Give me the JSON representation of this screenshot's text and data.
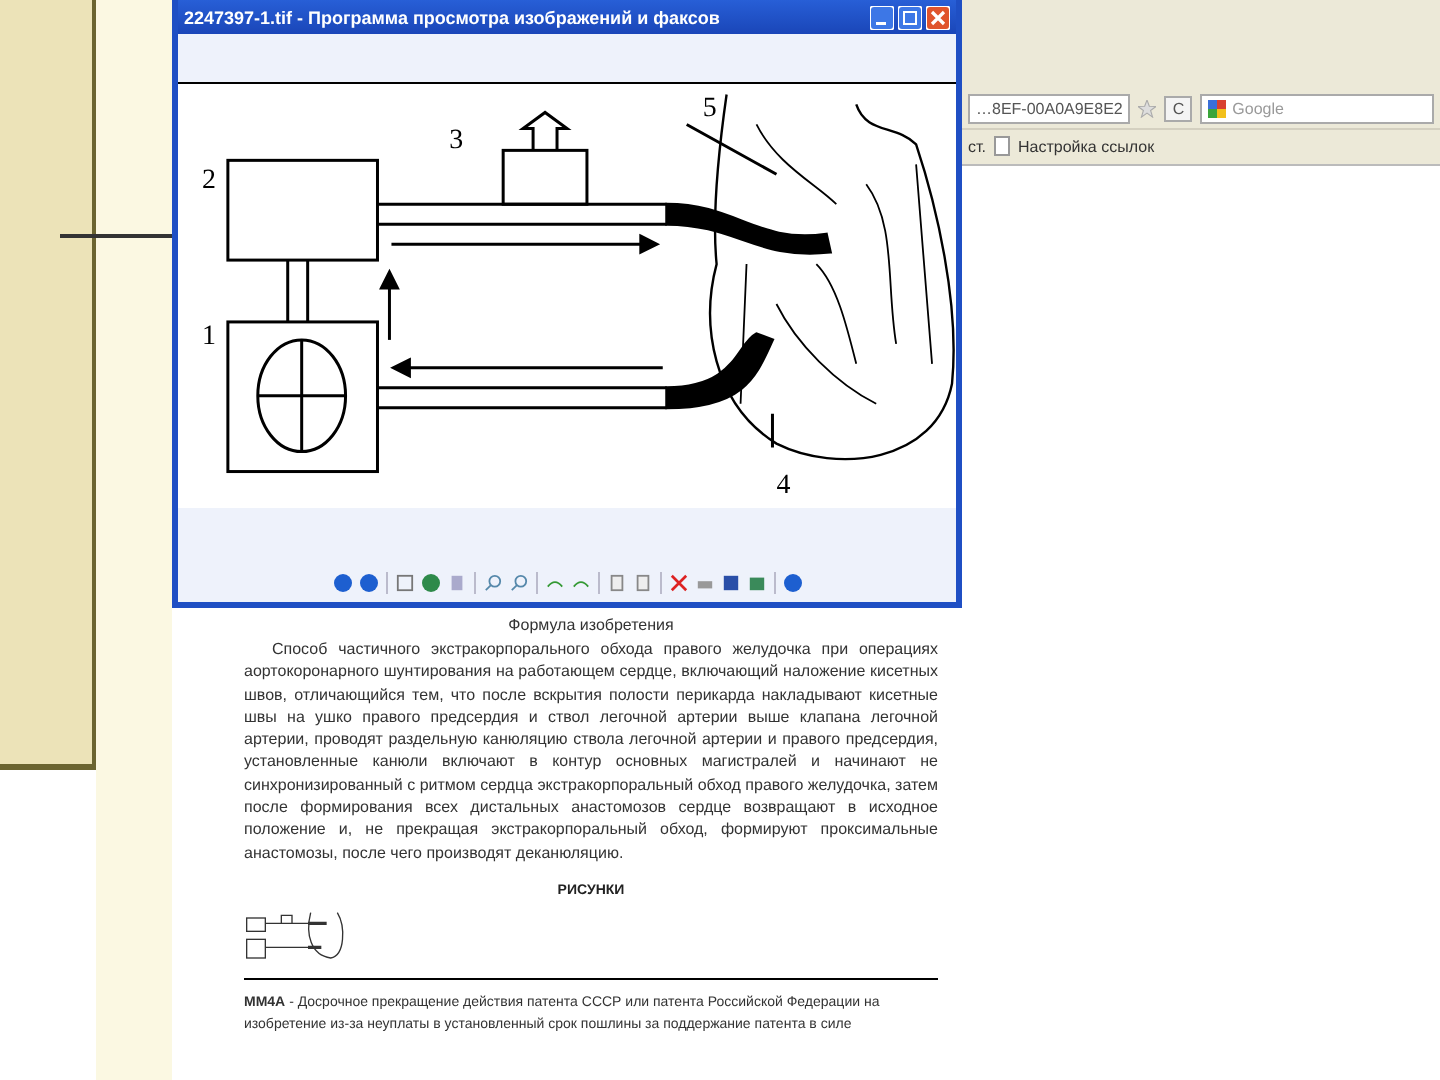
{
  "viewer": {
    "title": "2247397-1.tif - Программа просмотра изображений и факсов",
    "figure_labels": [
      "1",
      "2",
      "3",
      "4",
      "5"
    ]
  },
  "browser": {
    "address": "…8EF-00A0A9E8E2",
    "reload": "C",
    "search_placeholder": "Google",
    "bookmark_prefix": "ст.",
    "bookmark": "Настройка ссылок"
  },
  "document": {
    "heading": "Формула изобретения",
    "paragraph": "Способ частичного экстракорпорального обхода правого желудочка при операциях аортокоронарного шунтирования на работающем сердце, включающий наложение кисетных швов, отличающийся тем, что после вскрытия полости перикарда накладывают кисетные швы на ушко правого предсердия и ствол легочной артерии выше клапана легочной артерии, проводят раздельную канюляцию ствола легочной артерии и правого предсердия, установленные канюли включают в контур основных магистралей и начинают не синхронизированный с ритмом сердца экстракорпоральный обход правого желудочка, затем после формирования всех дистальных анастомозов сердце возвращают в исходное положение и, не прекращая экстракорпоральный обход, формируют проксимальные анастомозы, после чего производят деканюляцию.",
    "figures_heading": "РИСУНКИ",
    "notice": "**MM4A** - Досрочное прекращение действия патента СССР или патента Российской Федерации на изобретение из-за неуплаты в установленный срок пошлины за поддержание патента в силе"
  }
}
